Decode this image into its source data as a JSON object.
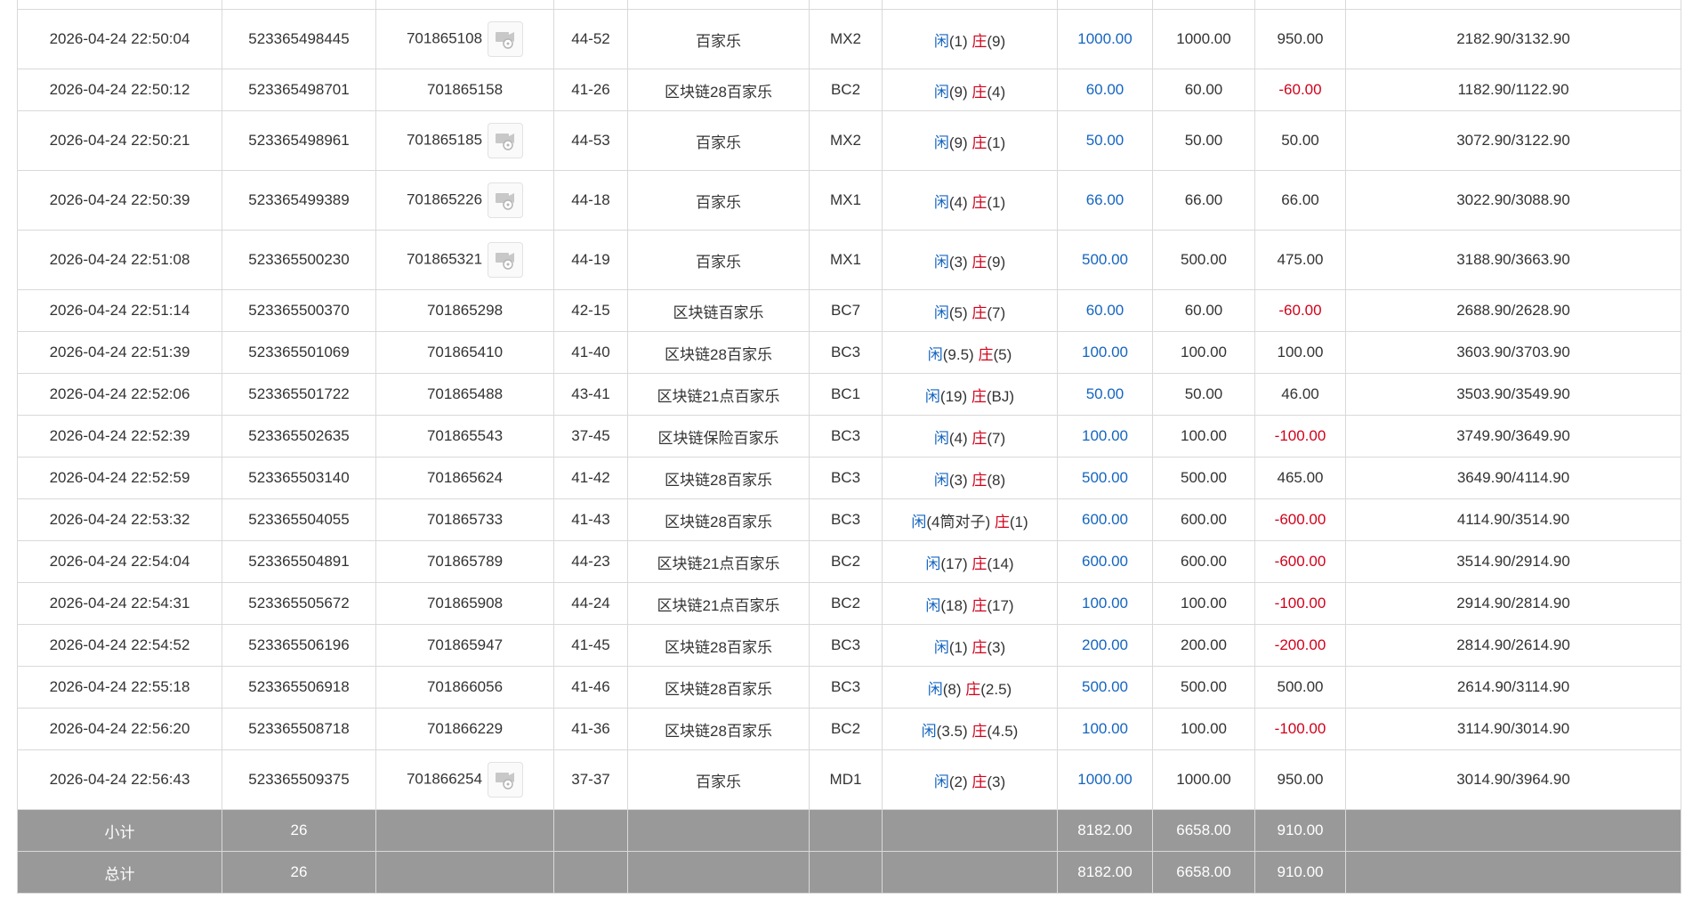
{
  "rows": [
    {
      "time": "2026-04-24 22:50:04",
      "bet_id": "523365498445",
      "round": "701865108",
      "video": true,
      "table": "44-52",
      "game": "百家乐",
      "shoe": "MX2",
      "player_label": "闲",
      "player_val": "(1)",
      "banker_label": "庄",
      "banker_val": "(9)",
      "bet": "1000.00",
      "valid": "1000.00",
      "win": "950.00",
      "win_neg": false,
      "balance": "2182.90/3132.90"
    },
    {
      "time": "2026-04-24 22:50:12",
      "bet_id": "523365498701",
      "round": "701865158",
      "video": false,
      "table": "41-26",
      "game": "区块链28百家乐",
      "shoe": "BC2",
      "player_label": "闲",
      "player_val": "(9)",
      "banker_label": "庄",
      "banker_val": "(4)",
      "bet": "60.00",
      "valid": "60.00",
      "win": "-60.00",
      "win_neg": true,
      "balance": "1182.90/1122.90"
    },
    {
      "time": "2026-04-24 22:50:21",
      "bet_id": "523365498961",
      "round": "701865185",
      "video": true,
      "table": "44-53",
      "game": "百家乐",
      "shoe": "MX2",
      "player_label": "闲",
      "player_val": "(9)",
      "banker_label": "庄",
      "banker_val": "(1)",
      "bet": "50.00",
      "valid": "50.00",
      "win": "50.00",
      "win_neg": false,
      "balance": "3072.90/3122.90"
    },
    {
      "time": "2026-04-24 22:50:39",
      "bet_id": "523365499389",
      "round": "701865226",
      "video": true,
      "table": "44-18",
      "game": "百家乐",
      "shoe": "MX1",
      "player_label": "闲",
      "player_val": "(4)",
      "banker_label": "庄",
      "banker_val": "(1)",
      "bet": "66.00",
      "valid": "66.00",
      "win": "66.00",
      "win_neg": false,
      "balance": "3022.90/3088.90"
    },
    {
      "time": "2026-04-24 22:51:08",
      "bet_id": "523365500230",
      "round": "701865321",
      "video": true,
      "table": "44-19",
      "game": "百家乐",
      "shoe": "MX1",
      "player_label": "闲",
      "player_val": "(3)",
      "banker_label": "庄",
      "banker_val": "(9)",
      "bet": "500.00",
      "valid": "500.00",
      "win": "475.00",
      "win_neg": false,
      "balance": "3188.90/3663.90"
    },
    {
      "time": "2026-04-24 22:51:14",
      "bet_id": "523365500370",
      "round": "701865298",
      "video": false,
      "table": "42-15",
      "game": "区块链百家乐",
      "shoe": "BC7",
      "player_label": "闲",
      "player_val": "(5)",
      "banker_label": "庄",
      "banker_val": "(7)",
      "bet": "60.00",
      "valid": "60.00",
      "win": "-60.00",
      "win_neg": true,
      "balance": "2688.90/2628.90"
    },
    {
      "time": "2026-04-24 22:51:39",
      "bet_id": "523365501069",
      "round": "701865410",
      "video": false,
      "table": "41-40",
      "game": "区块链28百家乐",
      "shoe": "BC3",
      "player_label": "闲",
      "player_val": "(9.5)",
      "banker_label": "庄",
      "banker_val": "(5)",
      "bet": "100.00",
      "valid": "100.00",
      "win": "100.00",
      "win_neg": false,
      "balance": "3603.90/3703.90"
    },
    {
      "time": "2026-04-24 22:52:06",
      "bet_id": "523365501722",
      "round": "701865488",
      "video": false,
      "table": "43-41",
      "game": "区块链21点百家乐",
      "shoe": "BC1",
      "player_label": "闲",
      "player_val": "(19)",
      "banker_label": "庄",
      "banker_val": "(BJ)",
      "bet": "50.00",
      "valid": "50.00",
      "win": "46.00",
      "win_neg": false,
      "balance": "3503.90/3549.90"
    },
    {
      "time": "2026-04-24 22:52:39",
      "bet_id": "523365502635",
      "round": "701865543",
      "video": false,
      "table": "37-45",
      "game": "区块链保险百家乐",
      "shoe": "BC3",
      "player_label": "闲",
      "player_val": "(4)",
      "banker_label": "庄",
      "banker_val": "(7)",
      "bet": "100.00",
      "valid": "100.00",
      "win": "-100.00",
      "win_neg": true,
      "balance": "3749.90/3649.90"
    },
    {
      "time": "2026-04-24 22:52:59",
      "bet_id": "523365503140",
      "round": "701865624",
      "video": false,
      "table": "41-42",
      "game": "区块链28百家乐",
      "shoe": "BC3",
      "player_label": "闲",
      "player_val": "(3)",
      "banker_label": "庄",
      "banker_val": "(8)",
      "bet": "500.00",
      "valid": "500.00",
      "win": "465.00",
      "win_neg": false,
      "balance": "3649.90/4114.90"
    },
    {
      "time": "2026-04-24 22:53:32",
      "bet_id": "523365504055",
      "round": "701865733",
      "video": false,
      "table": "41-43",
      "game": "区块链28百家乐",
      "shoe": "BC3",
      "player_label": "闲",
      "player_val": "(4筒对子)",
      "banker_label": "庄",
      "banker_val": "(1)",
      "bet": "600.00",
      "valid": "600.00",
      "win": "-600.00",
      "win_neg": true,
      "balance": "4114.90/3514.90"
    },
    {
      "time": "2026-04-24 22:54:04",
      "bet_id": "523365504891",
      "round": "701865789",
      "video": false,
      "table": "44-23",
      "game": "区块链21点百家乐",
      "shoe": "BC2",
      "player_label": "闲",
      "player_val": "(17)",
      "banker_label": "庄",
      "banker_val": "(14)",
      "bet": "600.00",
      "valid": "600.00",
      "win": "-600.00",
      "win_neg": true,
      "balance": "3514.90/2914.90"
    },
    {
      "time": "2026-04-24 22:54:31",
      "bet_id": "523365505672",
      "round": "701865908",
      "video": false,
      "table": "44-24",
      "game": "区块链21点百家乐",
      "shoe": "BC2",
      "player_label": "闲",
      "player_val": "(18)",
      "banker_label": "庄",
      "banker_val": "(17)",
      "bet": "100.00",
      "valid": "100.00",
      "win": "-100.00",
      "win_neg": true,
      "balance": "2914.90/2814.90"
    },
    {
      "time": "2026-04-24 22:54:52",
      "bet_id": "523365506196",
      "round": "701865947",
      "video": false,
      "table": "41-45",
      "game": "区块链28百家乐",
      "shoe": "BC3",
      "player_label": "闲",
      "player_val": "(1)",
      "banker_label": "庄",
      "banker_val": "(3)",
      "bet": "200.00",
      "valid": "200.00",
      "win": "-200.00",
      "win_neg": true,
      "balance": "2814.90/2614.90"
    },
    {
      "time": "2026-04-24 22:55:18",
      "bet_id": "523365506918",
      "round": "701866056",
      "video": false,
      "table": "41-46",
      "game": "区块链28百家乐",
      "shoe": "BC3",
      "player_label": "闲",
      "player_val": "(8)",
      "banker_label": "庄",
      "banker_val": "(2.5)",
      "bet": "500.00",
      "valid": "500.00",
      "win": "500.00",
      "win_neg": false,
      "balance": "2614.90/3114.90"
    },
    {
      "time": "2026-04-24 22:56:20",
      "bet_id": "523365508718",
      "round": "701866229",
      "video": false,
      "table": "41-36",
      "game": "区块链28百家乐",
      "shoe": "BC2",
      "player_label": "闲",
      "player_val": "(3.5)",
      "banker_label": "庄",
      "banker_val": "(4.5)",
      "bet": "100.00",
      "valid": "100.00",
      "win": "-100.00",
      "win_neg": true,
      "balance": "3114.90/3014.90"
    },
    {
      "time": "2026-04-24 22:56:43",
      "bet_id": "523365509375",
      "round": "701866254",
      "video": true,
      "table": "37-37",
      "game": "百家乐",
      "shoe": "MD1",
      "player_label": "闲",
      "player_val": "(2)",
      "banker_label": "庄",
      "banker_val": "(3)",
      "bet": "1000.00",
      "valid": "1000.00",
      "win": "950.00",
      "win_neg": false,
      "balance": "3014.90/3964.90"
    }
  ],
  "subtotal": {
    "label": "小计",
    "count": "26",
    "bet": "8182.00",
    "valid": "6658.00",
    "win": "910.00"
  },
  "total": {
    "label": "总计",
    "count": "26",
    "bet": "8182.00",
    "valid": "6658.00",
    "win": "910.00"
  },
  "colors": {
    "link_blue": "#1565c0",
    "loss_red": "#d0021b",
    "summary_bg": "#999999"
  },
  "icons": {
    "video": "video-replay-icon"
  }
}
